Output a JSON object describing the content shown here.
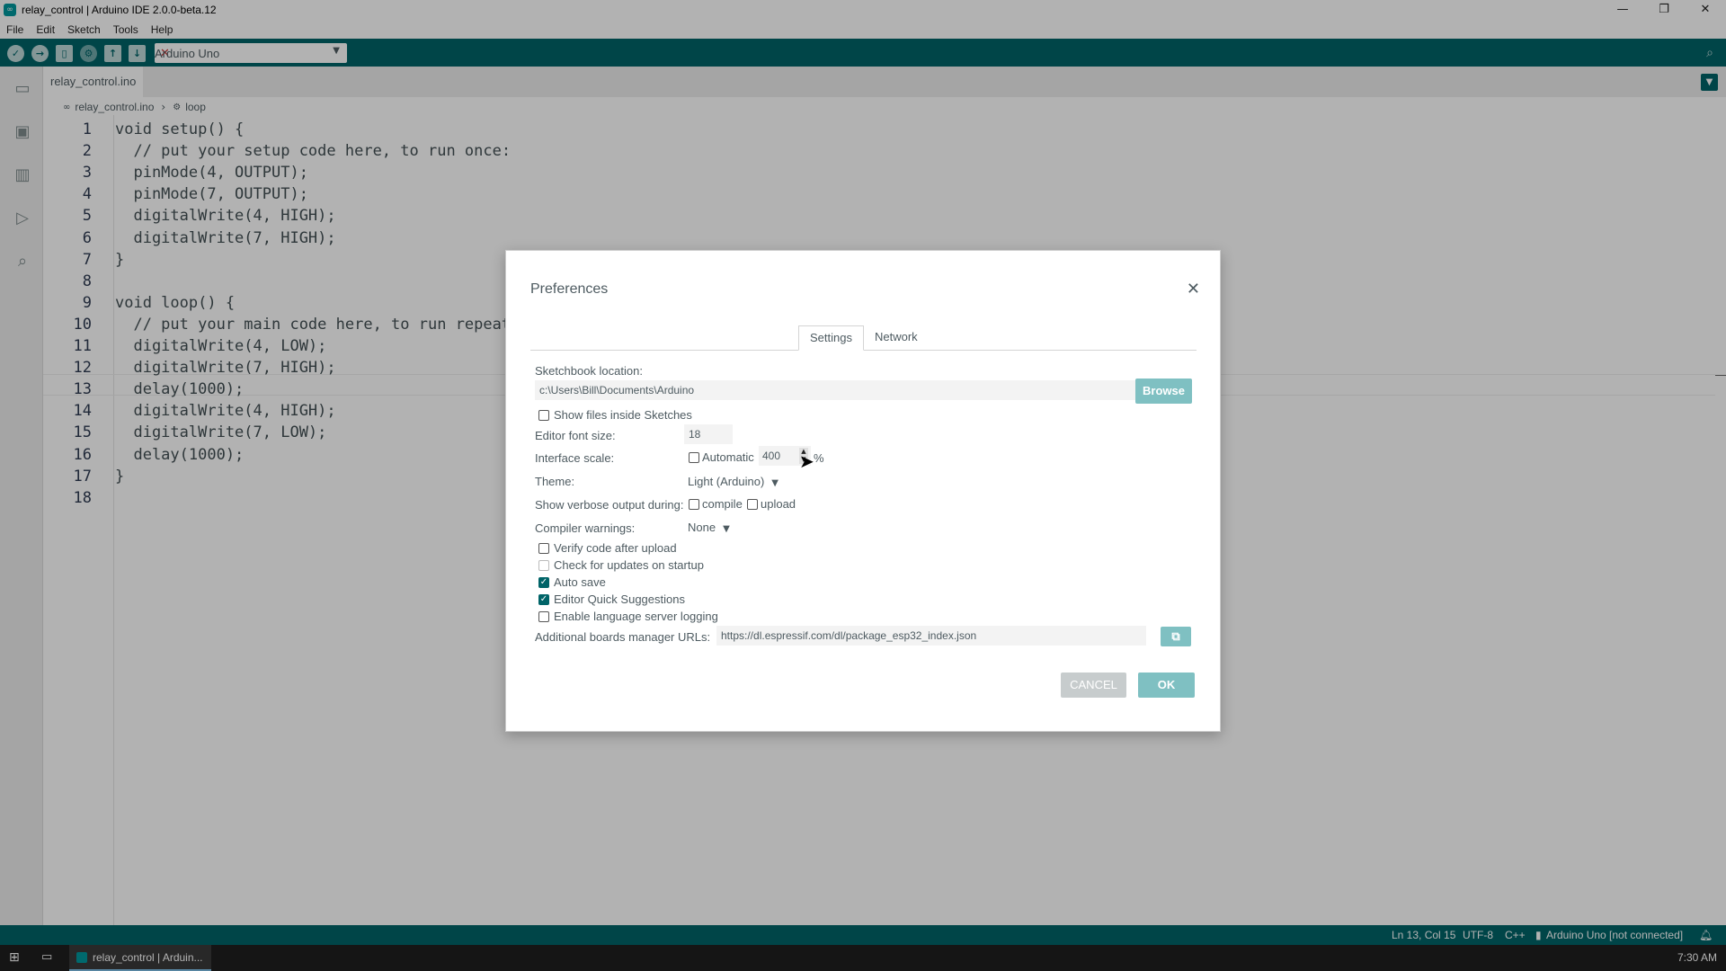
{
  "window": {
    "title": "relay_control | Arduino IDE 2.0.0-beta.12",
    "controls": [
      "—",
      "❐",
      "✕"
    ]
  },
  "menu": [
    "File",
    "Edit",
    "Sketch",
    "Tools",
    "Help"
  ],
  "toolbar": {
    "board": "Arduino Uno",
    "accent": "#006468"
  },
  "tab": {
    "filename": "relay_control.ino"
  },
  "breadcrumb": {
    "file": "relay_control.ino",
    "symbol": "loop"
  },
  "code": {
    "line_numbers": [
      "1",
      "2",
      "3",
      "4",
      "5",
      "6",
      "7",
      "8",
      "9",
      "10",
      "11",
      "12",
      "13",
      "14",
      "15",
      "16",
      "17",
      "18"
    ],
    "lines": [
      "void setup() {",
      "  // put your setup code here, to run once:",
      "  pinMode(4, OUTPUT);",
      "  pinMode(7, OUTPUT);",
      "  digitalWrite(4, HIGH);",
      "  digitalWrite(7, HIGH);",
      "}",
      "",
      "void loop() {",
      "  // put your main code here, to run repeate",
      "  digitalWrite(4, LOW);",
      "  digitalWrite(7, HIGH);",
      "  delay(1000);",
      "  digitalWrite(4, HIGH);",
      "  digitalWrite(7, LOW);",
      "  delay(1000);",
      "}",
      ""
    ]
  },
  "statusbar": {
    "position": "Ln 13, Col 15",
    "encoding": "UTF-8",
    "language": "C++",
    "board": "Arduino Uno [not connected]"
  },
  "taskbar": {
    "app": "relay_control | Arduin...",
    "time": "7:30 AM"
  },
  "preferences": {
    "title": "Preferences",
    "tabs": [
      "Settings",
      "Network"
    ],
    "sketchbook_label": "Sketchbook location:",
    "sketchbook_path": "c:\\Users\\Bill\\Documents\\Arduino",
    "browse": "Browse",
    "show_files": "Show files inside Sketches",
    "font_size_label": "Editor font size:",
    "font_size": "18",
    "scale_label": "Interface scale:",
    "automatic": "Automatic",
    "scale_value": "400",
    "percent": "%",
    "theme_label": "Theme:",
    "theme": "Light (Arduino)",
    "verbose_label": "Show verbose output during:",
    "compile": "compile",
    "upload": "upload",
    "warnings_label": "Compiler warnings:",
    "warnings": "None",
    "verify": "Verify code after upload",
    "check_updates": "Check for updates on startup",
    "auto_save": "Auto save",
    "quick_suggestions": "Editor Quick Suggestions",
    "ls_logging": "Enable language server logging",
    "boards_url_label": "Additional boards manager URLs:",
    "boards_url": "https://dl.espressif.com/dl/package_esp32_index.json",
    "cancel": "CANCEL",
    "ok": "OK"
  }
}
